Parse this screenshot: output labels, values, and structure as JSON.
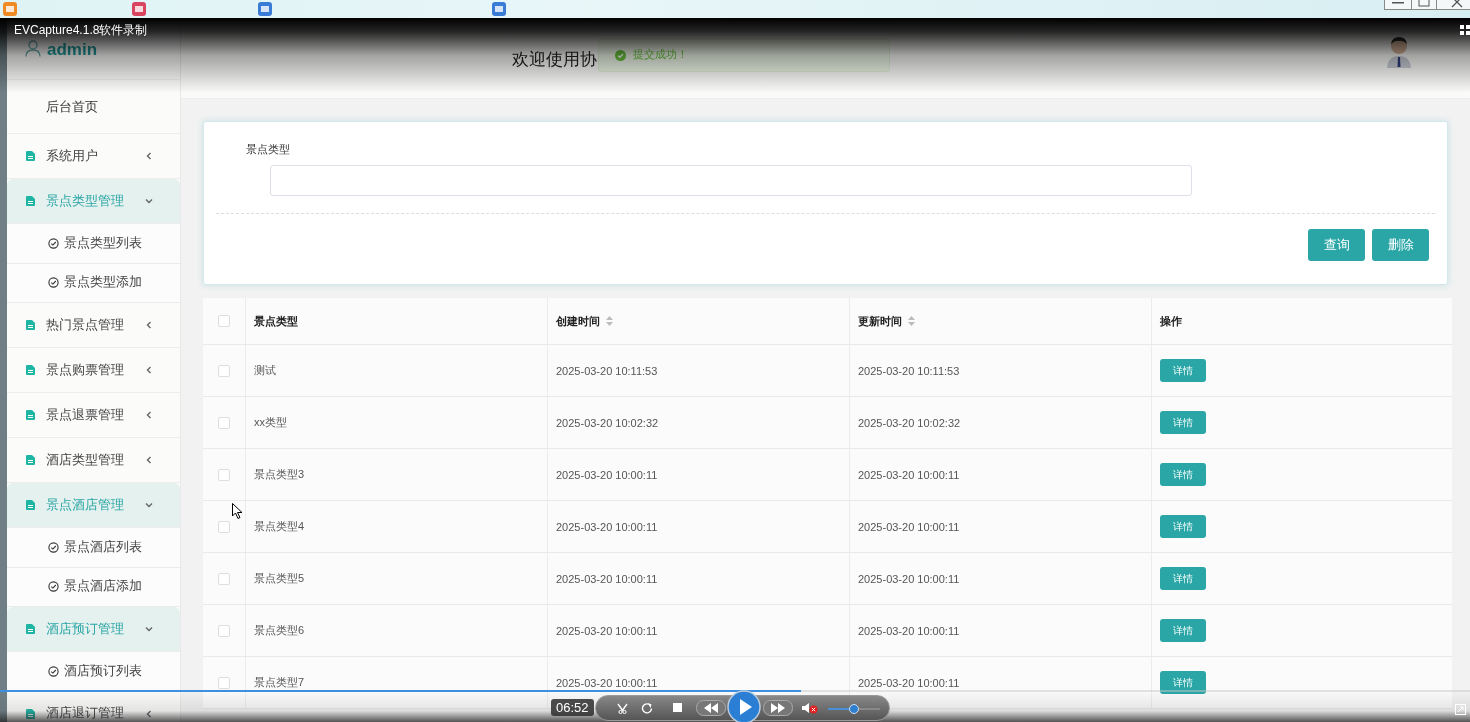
{
  "recorder": {
    "title": "EVCapture4.1.8软件录制",
    "time": "06:52",
    "progress": {
      "level": 0.545
    },
    "volume": {
      "level": 0.5
    }
  },
  "sidebar": {
    "user": "admin",
    "items": [
      {
        "label": "后台首页",
        "kind": "home"
      },
      {
        "label": "系统用户",
        "kind": "menu",
        "expanded": false
      },
      {
        "label": "景点类型管理",
        "kind": "menu",
        "expanded": true,
        "children": [
          {
            "label": "景点类型列表"
          },
          {
            "label": "景点类型添加"
          }
        ]
      },
      {
        "label": "热门景点管理",
        "kind": "menu",
        "expanded": false
      },
      {
        "label": "景点购票管理",
        "kind": "menu",
        "expanded": false
      },
      {
        "label": "景点退票管理",
        "kind": "menu",
        "expanded": false
      },
      {
        "label": "酒店类型管理",
        "kind": "menu",
        "expanded": false
      },
      {
        "label": "景点酒店管理",
        "kind": "menu",
        "expanded": true,
        "children": [
          {
            "label": "景点酒店列表"
          },
          {
            "label": "景点酒店添加"
          }
        ]
      },
      {
        "label": "酒店预订管理",
        "kind": "menu",
        "expanded": true,
        "children": [
          {
            "label": "酒店预订列表"
          }
        ]
      },
      {
        "label": "酒店退订管理",
        "kind": "menu",
        "expanded": false
      }
    ]
  },
  "header": {
    "title": "欢迎使用协"
  },
  "toast": {
    "message": "提交成功！"
  },
  "search": {
    "fields": [
      {
        "label": "景点类型"
      }
    ],
    "buttons": [
      "查询",
      "删除"
    ]
  },
  "table": {
    "all_checked": false,
    "columns": [
      {
        "label": "景点类型",
        "sortable": false
      },
      {
        "label": "创建时间",
        "sortable": true
      },
      {
        "label": "更新时间",
        "sortable": true
      },
      {
        "label": "操作",
        "sortable": false
      }
    ],
    "rows": [
      {
        "checked": false,
        "cells": [
          "测试",
          "2025-03-20 10:11:53",
          "2025-03-20 10:11:53"
        ],
        "action": "详情"
      },
      {
        "checked": false,
        "cells": [
          "xx类型",
          "2025-03-20 10:02:32",
          "2025-03-20 10:02:32"
        ],
        "action": "详情"
      },
      {
        "checked": false,
        "cells": [
          "景点类型3",
          "2025-03-20 10:00:11",
          "2025-03-20 10:00:11"
        ],
        "action": "详情"
      },
      {
        "checked": false,
        "cells": [
          "景点类型4",
          "2025-03-20 10:00:11",
          "2025-03-20 10:00:11"
        ],
        "action": "详情"
      },
      {
        "checked": false,
        "cells": [
          "景点类型5",
          "2025-03-20 10:00:11",
          "2025-03-20 10:00:11"
        ],
        "action": "详情"
      },
      {
        "checked": false,
        "cells": [
          "景点类型6",
          "2025-03-20 10:00:11",
          "2025-03-20 10:00:11"
        ],
        "action": "详情"
      },
      {
        "checked": false,
        "cells": [
          "景点类型7",
          "2025-03-20 10:00:11",
          "2025-03-20 10:00:11"
        ],
        "action": "详情"
      }
    ]
  }
}
